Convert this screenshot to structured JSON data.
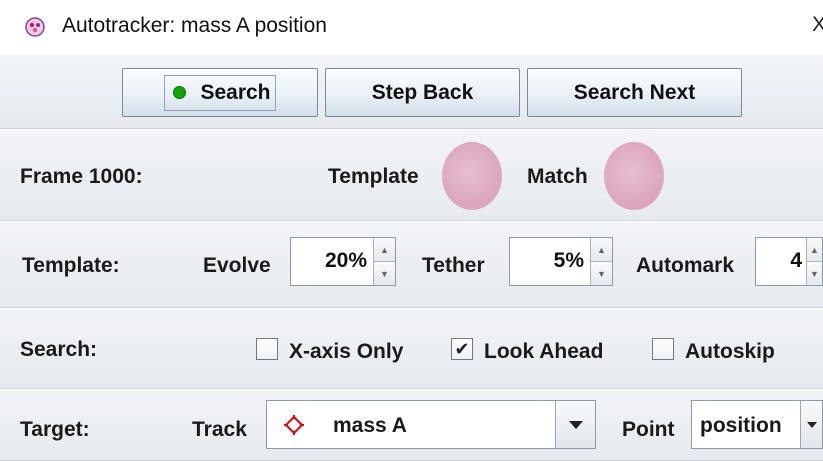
{
  "window": {
    "title": "Autotracker: mass A position",
    "close_glyph": "X",
    "icon": "autotracker-app-icon"
  },
  "toolbar": {
    "search_label": "Search",
    "step_back_label": "Step Back",
    "search_next_label": "Search Next",
    "search_indicator_color": "#0fa800"
  },
  "frame_row": {
    "label": "Frame 1000:",
    "template_label": "Template",
    "match_label": "Match",
    "swatch_color": "#dca8be"
  },
  "template_row": {
    "label": "Template:",
    "evolve_label": "Evolve",
    "evolve_value": "20%",
    "tether_label": "Tether",
    "tether_value": "5%",
    "automark_label": "Automark",
    "automark_value": "4"
  },
  "search_row": {
    "label": "Search:",
    "x_axis_only": {
      "label": "X-axis Only",
      "checked": false
    },
    "look_ahead": {
      "label": "Look Ahead",
      "checked": true
    },
    "autoskip": {
      "label": "Autoskip",
      "checked": false
    }
  },
  "target_row": {
    "label": "Target:",
    "track_label": "Track",
    "track_value": "mass A",
    "track_icon_color": "#e8000c",
    "point_label": "Point",
    "point_value": "position"
  }
}
